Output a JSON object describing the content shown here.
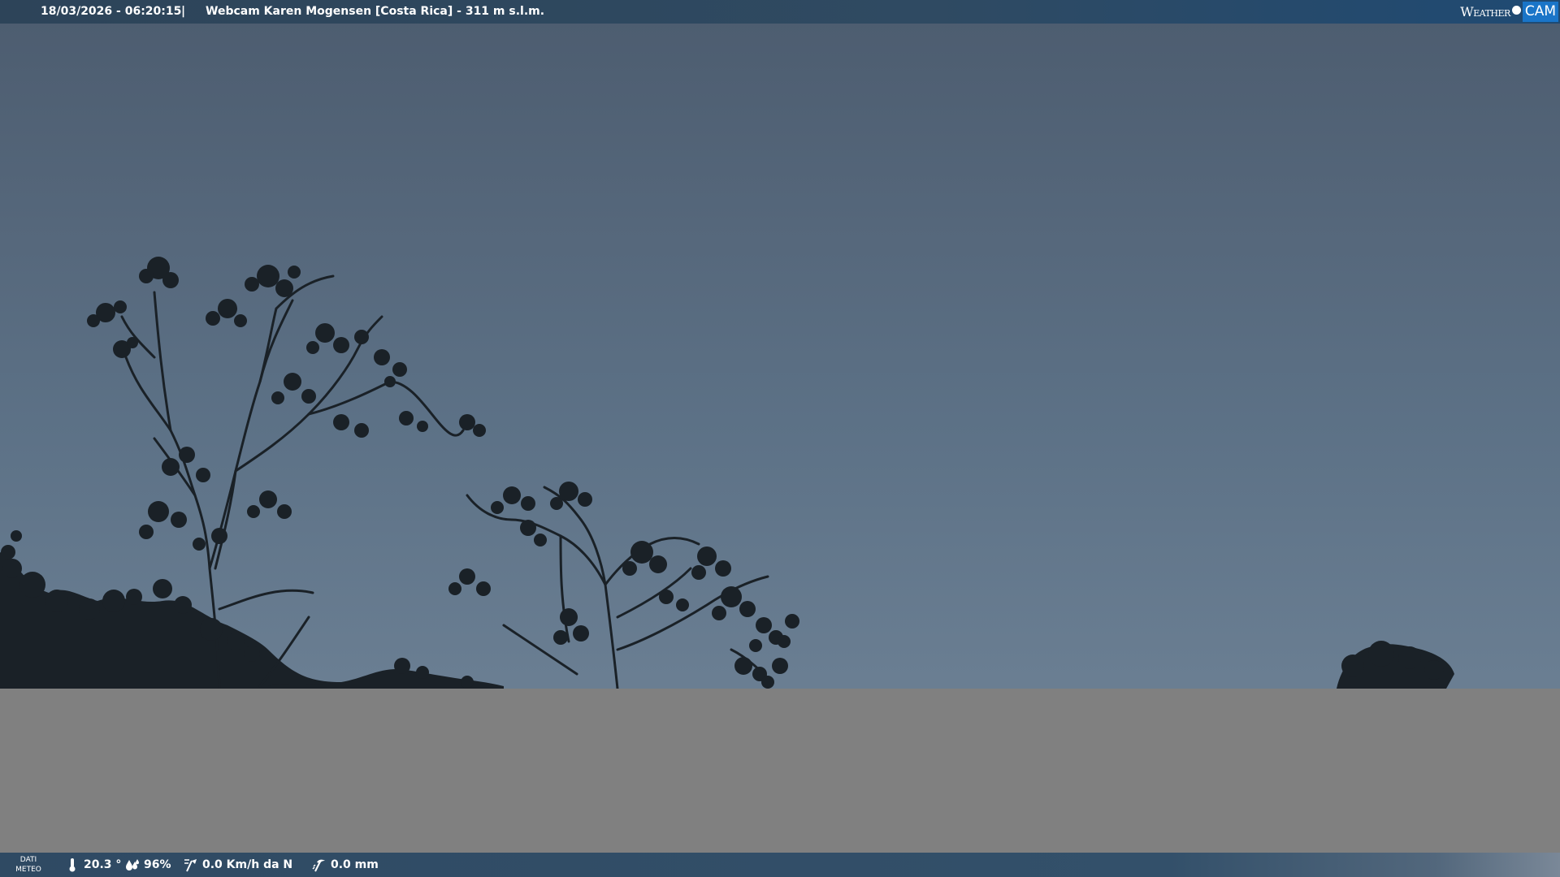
{
  "header": {
    "timestamp": "18/03/2026 - 06:20:15",
    "separator": "|",
    "title": "Webcam Karen Mogensen [Costa Rica]  - 311 m s.l.m.",
    "brand": {
      "weather_text": "Weather",
      "cam_text": "CAM",
      "accent_color": "#1a75c8"
    }
  },
  "image": {
    "description_icon": "webcam-scene",
    "sky_color": "#5a6e83",
    "fill_color": "#808080"
  },
  "weather_bar": {
    "label": "DATI METEO",
    "temperature": {
      "icon": "thermometer-icon",
      "value": "20.3 °"
    },
    "humidity": {
      "icon": "humidity-icon",
      "value": "96%"
    },
    "wind": {
      "icon": "wind-icon",
      "value": "0.0 Km/h da N"
    },
    "rain": {
      "icon": "rain-icon",
      "value": "0.0 mm"
    }
  }
}
